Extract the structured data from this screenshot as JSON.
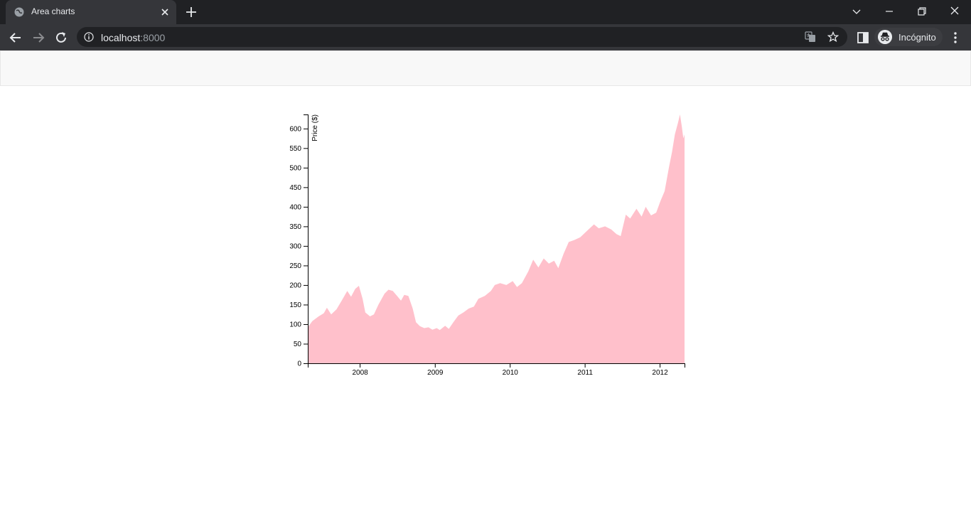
{
  "browser": {
    "tab_title": "Area charts",
    "url_host": "localhost",
    "url_port": ":8000",
    "profile_label": "Incógnito",
    "icons": [
      "globe-icon",
      "close-icon",
      "plus-icon",
      "chevron-down-icon",
      "minimize-icon",
      "restore-icon",
      "window-close-icon",
      "back-icon",
      "forward-icon",
      "reload-icon",
      "info-icon",
      "translate-icon",
      "star-icon",
      "sidepanel-icon",
      "incognito-icon",
      "menu-icon"
    ]
  },
  "chart_data": {
    "type": "area",
    "title": "",
    "xlabel": "",
    "ylabel": "Price ($)",
    "fill_color": "#ffc0cb",
    "xlim": [
      "2007-04-23",
      "2012-05-01"
    ],
    "ylim": [
      0,
      636
    ],
    "yticks": [
      0,
      50,
      100,
      150,
      200,
      250,
      300,
      350,
      400,
      450,
      500,
      550,
      600
    ],
    "xticks": [
      "2008",
      "2009",
      "2010",
      "2011",
      "2012"
    ],
    "grid": false,
    "series": [
      {
        "points": [
          [
            "2007-04-23",
            92
          ],
          [
            "2007-05-15",
            108
          ],
          [
            "2007-06-15",
            120
          ],
          [
            "2007-07-10",
            128
          ],
          [
            "2007-07-25",
            142
          ],
          [
            "2007-08-15",
            125
          ],
          [
            "2007-09-10",
            138
          ],
          [
            "2007-10-05",
            160
          ],
          [
            "2007-11-01",
            185
          ],
          [
            "2007-11-20",
            170
          ],
          [
            "2007-12-10",
            190
          ],
          [
            "2007-12-28",
            198
          ],
          [
            "2008-01-15",
            165
          ],
          [
            "2008-01-28",
            130
          ],
          [
            "2008-02-20",
            120
          ],
          [
            "2008-03-10",
            125
          ],
          [
            "2008-04-01",
            150
          ],
          [
            "2008-05-01",
            178
          ],
          [
            "2008-05-20",
            188
          ],
          [
            "2008-06-10",
            185
          ],
          [
            "2008-07-01",
            172
          ],
          [
            "2008-07-20",
            160
          ],
          [
            "2008-08-05",
            175
          ],
          [
            "2008-08-25",
            172
          ],
          [
            "2008-09-15",
            140
          ],
          [
            "2008-10-01",
            105
          ],
          [
            "2008-10-20",
            95
          ],
          [
            "2008-11-10",
            90
          ],
          [
            "2008-12-01",
            92
          ],
          [
            "2008-12-20",
            86
          ],
          [
            "2009-01-10",
            90
          ],
          [
            "2009-01-25",
            85
          ],
          [
            "2009-02-20",
            96
          ],
          [
            "2009-03-10",
            88
          ],
          [
            "2009-04-01",
            105
          ],
          [
            "2009-04-25",
            122
          ],
          [
            "2009-05-20",
            130
          ],
          [
            "2009-06-15",
            140
          ],
          [
            "2009-07-10",
            145
          ],
          [
            "2009-08-01",
            165
          ],
          [
            "2009-09-01",
            172
          ],
          [
            "2009-10-01",
            185
          ],
          [
            "2009-10-20",
            200
          ],
          [
            "2009-11-15",
            205
          ],
          [
            "2009-12-15",
            200
          ],
          [
            "2010-01-15",
            210
          ],
          [
            "2010-02-05",
            195
          ],
          [
            "2010-03-01",
            205
          ],
          [
            "2010-04-01",
            235
          ],
          [
            "2010-04-25",
            265
          ],
          [
            "2010-05-20",
            245
          ],
          [
            "2010-06-15",
            268
          ],
          [
            "2010-07-10",
            255
          ],
          [
            "2010-08-05",
            262
          ],
          [
            "2010-08-25",
            243
          ],
          [
            "2010-09-20",
            280
          ],
          [
            "2010-10-15",
            310
          ],
          [
            "2010-11-10",
            315
          ],
          [
            "2010-12-10",
            322
          ],
          [
            "2011-01-15",
            340
          ],
          [
            "2011-02-15",
            355
          ],
          [
            "2011-03-10",
            345
          ],
          [
            "2011-04-10",
            350
          ],
          [
            "2011-05-10",
            342
          ],
          [
            "2011-06-05",
            330
          ],
          [
            "2011-06-25",
            325
          ],
          [
            "2011-07-20",
            380
          ],
          [
            "2011-08-10",
            370
          ],
          [
            "2011-09-10",
            395
          ],
          [
            "2011-10-05",
            375
          ],
          [
            "2011-10-25",
            400
          ],
          [
            "2011-11-20",
            378
          ],
          [
            "2011-12-15",
            385
          ],
          [
            "2012-01-05",
            415
          ],
          [
            "2012-01-25",
            440
          ],
          [
            "2012-02-15",
            500
          ],
          [
            "2012-03-01",
            540
          ],
          [
            "2012-03-15",
            585
          ],
          [
            "2012-03-30",
            615
          ],
          [
            "2012-04-09",
            636
          ],
          [
            "2012-04-18",
            605
          ],
          [
            "2012-04-25",
            575
          ],
          [
            "2012-05-01",
            585
          ]
        ]
      }
    ]
  }
}
